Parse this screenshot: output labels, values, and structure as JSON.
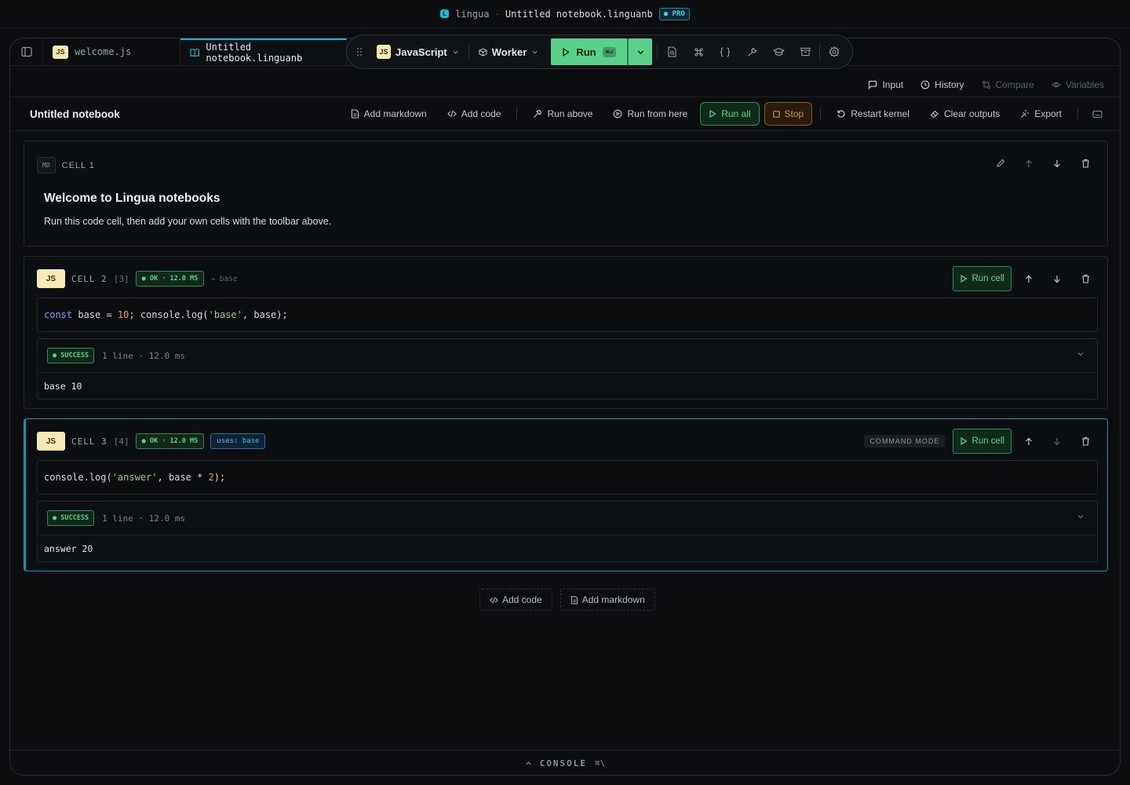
{
  "titlebar": {
    "logo_letter": "L",
    "app_name": "lingua",
    "separator": "·",
    "file_name": "Untitled notebook.linguanb",
    "badge": "● PRO"
  },
  "tabs": [
    {
      "badge": "JS",
      "label": "welcome.js"
    },
    {
      "label": "Untitled notebook.linguanb"
    }
  ],
  "toolbar": {
    "language_badge": "JS",
    "language": "JavaScript",
    "runtime": "Worker",
    "run_label": "Run",
    "run_shortcut": "⌘⏎",
    "icons": [
      "file-search-icon",
      "command-icon",
      "braces-icon",
      "wrench-icon",
      "graduation-cap-icon",
      "archive-icon",
      "settings-icon"
    ]
  },
  "panel_links": {
    "input": "Input",
    "history": "History",
    "compare": "Compare",
    "variables": "Variables"
  },
  "notebook": {
    "title": "Untitled notebook",
    "actions": {
      "add_markdown": "Add markdown",
      "add_code": "Add code",
      "run_above": "Run above",
      "run_from_here": "Run from here",
      "run_all": "Run all",
      "stop": "Stop",
      "restart_kernel": "Restart kernel",
      "clear_outputs": "Clear outputs",
      "export": "Export"
    }
  },
  "cells": [
    {
      "type_tag": "MD",
      "label": "CELL 1",
      "heading": "Welcome to Lingua notebooks",
      "body": "Run this code cell, then add your own cells with the toolbar above."
    },
    {
      "type_tag": "JS",
      "label": "CELL 2",
      "count": "[3]",
      "status": "● OK · 12.0 MS",
      "dependency": "→ base",
      "run_label": "Run cell",
      "code": {
        "kw": "const",
        "p1": " base = ",
        "num": "10",
        "p2": "; console.log(",
        "str": "'base'",
        "p3": ", base);"
      },
      "output": {
        "status": "● SUCCESS",
        "meta": "1 line · 12.0 ms",
        "text": "base 10"
      }
    },
    {
      "type_tag": "JS",
      "label": "CELL 3",
      "count": "[4]",
      "status": "● OK · 12.0 MS",
      "uses": "uses: base",
      "mode": "COMMAND MODE",
      "run_label": "Run cell",
      "code": {
        "p1": "console.log(",
        "str": "'answer'",
        "p2": ", base * ",
        "num": "2",
        "p3": ");"
      },
      "output": {
        "status": "● SUCCESS",
        "meta": "1 line · 12.0 ms",
        "text": "answer 20"
      }
    }
  ],
  "add_row": {
    "add_code": "Add code",
    "add_markdown": "Add markdown"
  },
  "console": {
    "label": "CONSOLE",
    "shortcut": "⌘\\"
  },
  "colors": {
    "accent": "#1fb5d6",
    "success": "#5ad08b",
    "warning": "#d08a3c",
    "background": "#0b0d0f"
  }
}
